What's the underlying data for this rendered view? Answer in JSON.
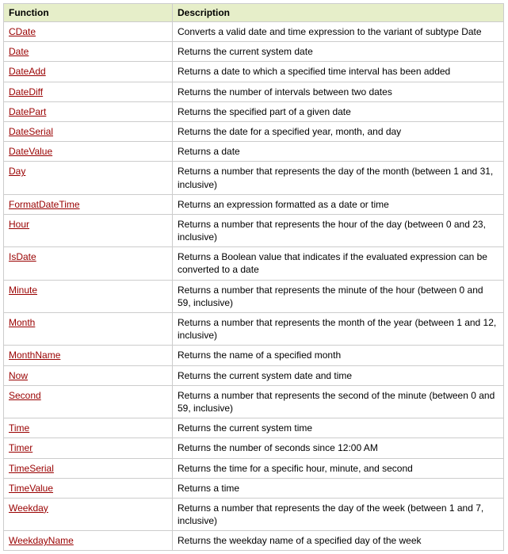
{
  "headers": {
    "function": "Function",
    "description": "Description"
  },
  "rows": [
    {
      "function": "CDate",
      "description": "Converts a valid date and time expression to the variant of subtype Date"
    },
    {
      "function": "Date",
      "description": "Returns the current system date"
    },
    {
      "function": "DateAdd",
      "description": "Returns a date to which a specified time interval has been added"
    },
    {
      "function": "DateDiff",
      "description": "Returns the number of intervals between two dates"
    },
    {
      "function": "DatePart",
      "description": "Returns the specified part of a given date"
    },
    {
      "function": "DateSerial",
      "description": "Returns the date for a specified year, month, and day"
    },
    {
      "function": "DateValue",
      "description": "Returns a date"
    },
    {
      "function": "Day",
      "description": "Returns a number that represents the day of the month (between 1 and 31, inclusive)"
    },
    {
      "function": "FormatDateTime",
      "description": "Returns an expression formatted as a date or time"
    },
    {
      "function": "Hour",
      "description": "Returns a number that represents the hour of the day (between 0 and 23, inclusive)"
    },
    {
      "function": "IsDate",
      "description": "Returns a Boolean value that indicates if the evaluated expression can be converted to a date"
    },
    {
      "function": "Minute",
      "description": "Returns a number that represents the minute of the hour (between 0 and 59, inclusive)"
    },
    {
      "function": "Month",
      "description": "Returns a number that represents the month of the year (between 1 and 12, inclusive)"
    },
    {
      "function": "MonthName",
      "description": "Returns the name of a specified month"
    },
    {
      "function": "Now",
      "description": "Returns the current system date and time"
    },
    {
      "function": "Second",
      "description": "Returns a number that represents the second of the minute (between 0 and 59, inclusive)"
    },
    {
      "function": "Time",
      "description": "Returns the current system time"
    },
    {
      "function": "Timer",
      "description": "Returns the number of seconds since 12:00 AM"
    },
    {
      "function": "TimeSerial",
      "description": "Returns the time for a specific hour, minute, and second"
    },
    {
      "function": "TimeValue",
      "description": "Returns a time"
    },
    {
      "function": "Weekday",
      "description": "Returns a number that represents the day of the week (between 1 and 7, inclusive)"
    },
    {
      "function": "WeekdayName",
      "description": "Returns the weekday name of a specified day of the week"
    }
  ]
}
